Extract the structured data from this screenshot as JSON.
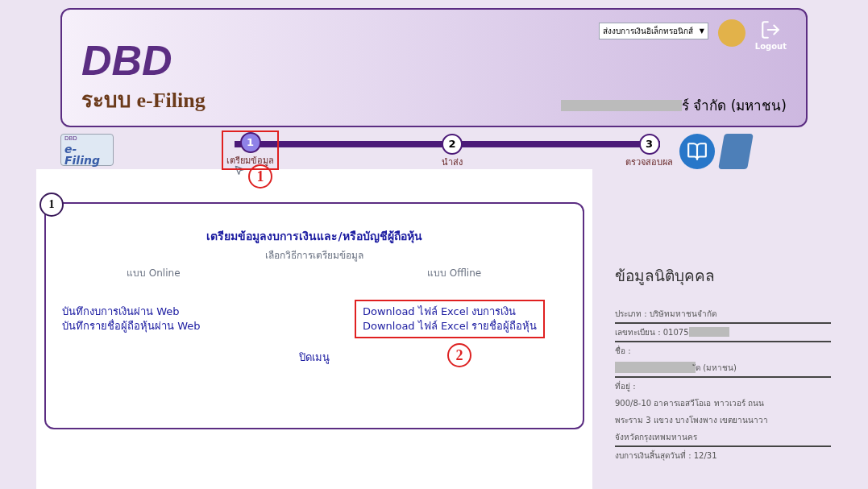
{
  "header": {
    "logo": "DBD",
    "system_title": "ระบบ ",
    "system_title_bold": "e-Filing",
    "menu_select": "ส่งงบการเงินอิเล็กทรอนิกส์",
    "caret": "▼",
    "logout": "Logout",
    "company_visible": "ร์ จำกัด (มหาชน)"
  },
  "badge": {
    "small": "DBD",
    "text": "e-Filing"
  },
  "steps": [
    {
      "number": "1",
      "label": "เตรียมข้อมูล",
      "selected": true
    },
    {
      "number": "2",
      "label": "นำส่ง",
      "selected": false
    },
    {
      "number": "3",
      "label": "ตรวจสอบผล",
      "selected": false
    }
  ],
  "annotations": [
    "1",
    "2"
  ],
  "card": {
    "number": "1",
    "title": "เตรียมข้อมูลงบการเงินและ/หรือบัญชีผู้ถือหุ้น",
    "subtitle": "เลือกวิธีการเตรียมข้อมูล",
    "columns": [
      {
        "heading": "แบบ Online",
        "links": [
          "บันทึกงบการเงินผ่าน Web",
          "บันทึกรายชื่อผู้ถือหุ้นผ่าน Web"
        ]
      },
      {
        "heading": "แบบ Offline",
        "links": [
          "Download ไฟล์ Excel งบการเงิน",
          "Download ไฟล์ Excel รายชื่อผู้ถือหุ้น"
        ]
      }
    ],
    "close": "ปิดเมนู"
  },
  "sidebar": {
    "title": "ข้อมูลนิติบุคคล",
    "groups": [
      {
        "lines": [
          {
            "text": "ประเภท : บริษัทมหาชนจำกัด",
            "redacted": false
          }
        ]
      },
      {
        "lines": [
          {
            "text": "เลขทะเบียน : 01075",
            "redacted": true
          }
        ]
      },
      {
        "lines": [
          {
            "text": "ชื่อ :",
            "redacted": false
          },
          {
            "text": "ัด (มหาชน)",
            "redacted": true
          }
        ]
      },
      {
        "lines": [
          {
            "text": "ที่อยู่ :",
            "redacted": false
          },
          {
            "text": "900/8-10 อาคารเอสวีโอเอ ทาวเวอร์ ถนน",
            "redacted": false
          },
          {
            "text": "พระราม 3 แขวง บางโพงพาง เขตยานนาวา",
            "redacted": false
          },
          {
            "text": "จังหวัดกรุงเทพมหานคร",
            "redacted": false
          }
        ]
      },
      {
        "lines": [
          {
            "text": "งบการเงินสิ้นสุดวันที่ : 12/31",
            "redacted": false
          }
        ]
      }
    ]
  }
}
